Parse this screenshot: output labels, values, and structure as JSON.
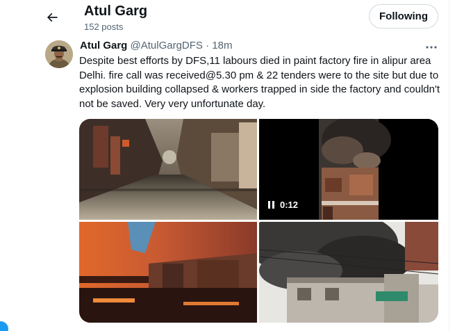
{
  "header": {
    "name": "Atul Garg",
    "post_count": "152 posts",
    "follow_label": "Following"
  },
  "tweet": {
    "author_name": "Atul Garg",
    "author_handle": "@AtulGargDFS",
    "separator": "·",
    "time": "18m",
    "text": "Despite best efforts by DFS,11 labours died in paint factory fire in alipur area Delhi. fire call was received@5.30 pm & 22 tenders were to the site but due to explosion building collapsed & workers trapped in side the factory and couldn't not be saved. Very very unfortunate day.",
    "media": {
      "video_duration": "0:12"
    }
  },
  "colors": {
    "accent": "#1d9bf0",
    "secondary_text": "#536471",
    "border": "#cfd9de"
  },
  "icons": [
    "back-arrow-icon",
    "more-dots-icon",
    "pause-icon"
  ]
}
